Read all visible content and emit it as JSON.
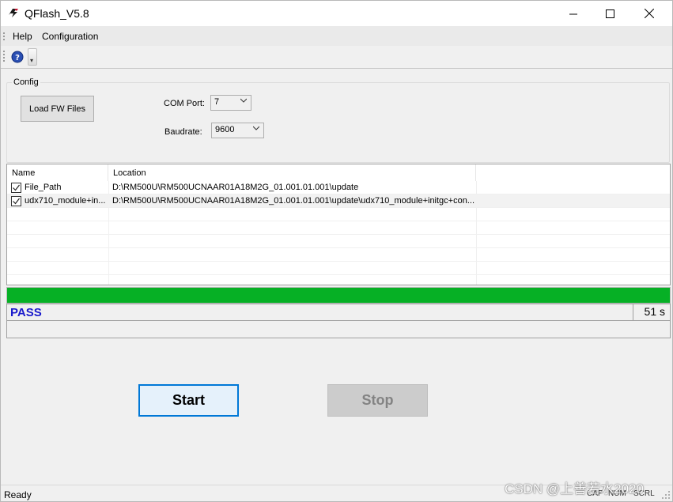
{
  "window": {
    "title": "QFlash_V5.8"
  },
  "menu": {
    "items": [
      "Help",
      "Configuration"
    ]
  },
  "config": {
    "group_label": "Config",
    "load_button": "Load FW Files",
    "com_port_label": "COM Port:",
    "com_port_value": "7",
    "baudrate_label": "Baudrate:",
    "baudrate_value": "9600"
  },
  "file_list": {
    "columns": [
      "Name",
      "Location"
    ],
    "rows": [
      {
        "checked": true,
        "name": "File_Path",
        "location": "D:\\RM500U\\RM500UCNAAR01A18M2G_01.001.01.001\\update"
      },
      {
        "checked": true,
        "name": "udx710_module+in...",
        "location": "D:\\RM500U\\RM500UCNAAR01A18M2G_01.001.01.001\\update\\udx710_module+initgc+con..."
      }
    ]
  },
  "progress": {
    "percent": 100,
    "color": "#06b025"
  },
  "result": {
    "status": "PASS",
    "elapsed": "51 s"
  },
  "actions": {
    "start_label": "Start",
    "stop_label": "Stop"
  },
  "statusbar": {
    "ready": "Ready",
    "cap": "CAP",
    "num": "NUM",
    "scrl": "SCRL"
  },
  "watermark": "CSDN @上善若水2020"
}
